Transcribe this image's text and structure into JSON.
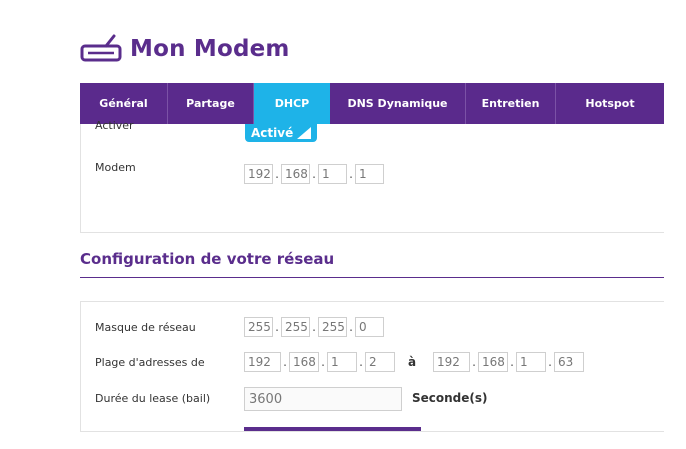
{
  "page": {
    "title": "Mon Modem",
    "icon": "modem-icon"
  },
  "colors": {
    "brand": "#5a2d8c",
    "accent": "#1eb3e8"
  },
  "tabs": [
    {
      "label": "Général",
      "active": false
    },
    {
      "label": "Partage",
      "active": false
    },
    {
      "label": "DHCP",
      "active": true
    },
    {
      "label": "DNS Dynamique",
      "active": false
    },
    {
      "label": "Entretien",
      "active": false
    },
    {
      "label": "Hotspot",
      "active": false
    }
  ],
  "dhcp": {
    "activate_label": "Activer",
    "toggle_state": "Activé",
    "modem_label": "Modem",
    "modem_ip": [
      "192",
      "168",
      "1",
      "1"
    ]
  },
  "network": {
    "section_title": "Configuration de votre réseau",
    "netmask_label": "Masque de réseau",
    "netmask": [
      "255",
      "255",
      "255",
      "0"
    ],
    "range_label": "Plage d'adresses de",
    "range_start": [
      "192",
      "168",
      "1",
      "2"
    ],
    "range_to": "à",
    "range_end": [
      "192",
      "168",
      "1",
      "63"
    ],
    "lease_label": "Durée du lease (bail)",
    "lease_value": "3600",
    "lease_unit": "Seconde(s)"
  }
}
